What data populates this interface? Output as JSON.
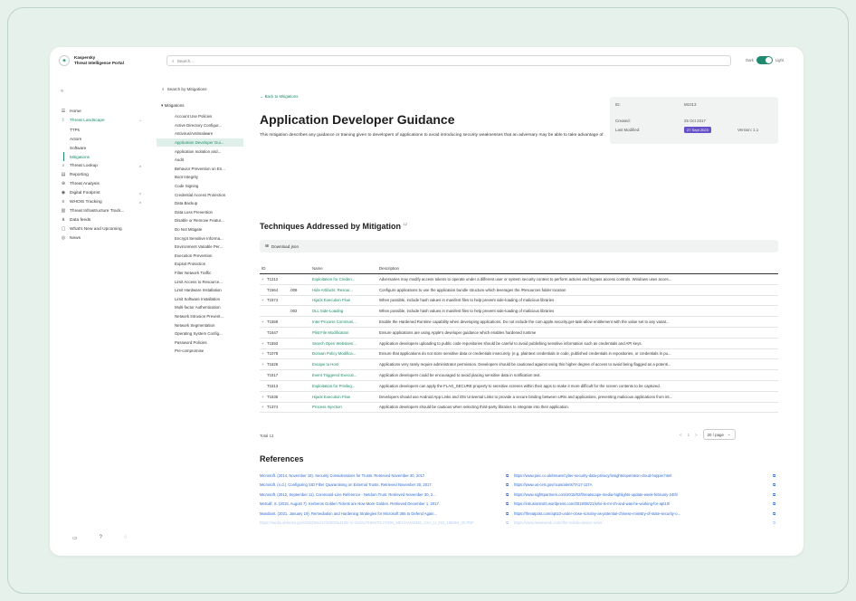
{
  "brand": {
    "line1": "Kaspersky",
    "line2": "Threat Intelligence Portal"
  },
  "search": {
    "placeholder": "Search..."
  },
  "theme": {
    "left": "Dark",
    "right": "Light"
  },
  "sidebar": {
    "collapse": "«",
    "items": [
      {
        "icon": "☰",
        "label": "Home"
      },
      {
        "icon": "⌇",
        "label": "Threat Landscape",
        "chev": "^"
      },
      {
        "label": "TTPs"
      },
      {
        "label": "Actors"
      },
      {
        "label": "Software"
      },
      {
        "label": "Mitigations"
      },
      {
        "icon": "⌕",
        "label": "Threat Lookup",
        "chev": "v"
      },
      {
        "icon": "▤",
        "label": "Reporting"
      },
      {
        "icon": "⊕",
        "label": "Threat Analysis"
      },
      {
        "icon": "◉",
        "label": "Digital Footprint",
        "chev": "v"
      },
      {
        "icon": "≡",
        "label": "WHOIS Tracking",
        "chev": "v"
      },
      {
        "icon": "▥",
        "label": "Threat Infrastructure Track..."
      },
      {
        "icon": "⋔",
        "label": "Data feeds"
      },
      {
        "icon": "▢",
        "label": "What's New and Upcoming"
      },
      {
        "icon": "◎",
        "label": "News"
      }
    ],
    "bottom": [
      "▭",
      "?",
      "◌"
    ]
  },
  "mitigations_list": {
    "search_label": "Search by Mitigations",
    "header": "Mitigations",
    "items": [
      "Account Use Policies",
      "Active Directory Configur...",
      "Antivirus/Antimalware",
      "Application Developer Gui...",
      "Application Isolation and...",
      "Audit",
      "Behavior Prevention on En...",
      "Boot Integrity",
      "Code Signing",
      "Credential Access Protection",
      "Data Backup",
      "Data Loss Prevention",
      "Disable or Remove Featur...",
      "Do Not Mitigate",
      "Encrypt Sensitive Informa...",
      "Environment Variable Per...",
      "Execution Prevention",
      "Exploit Protection",
      "Filter Network Traffic",
      "Limit Access to Resource...",
      "Limit Hardware Installation",
      "Limit Software Installation",
      "Multi-factor Authentication",
      "Network Intrusion Prevent...",
      "Network Segmentation",
      "Operating System Config...",
      "Password Policies",
      "Pre-compromise"
    ]
  },
  "detail": {
    "back": "← Back to Mitigations",
    "title": "Application Developer Guidance",
    "description": "This mitigation describes any guidance or training given to developers of applications to avoid introducing security weaknesses that an adversary may be able to take advantage of.",
    "meta": {
      "id_label": "ID:",
      "id_value": "M1013",
      "created_label": "Created:",
      "created_value": "25 Oct 2017",
      "modified_label": "Last Modified:",
      "modified_value": "27 Sept 2023",
      "version_label": "Version:",
      "version_value": "1.1"
    }
  },
  "techniques": {
    "title": "Techniques Addressed by Mitigation",
    "count": "12",
    "download": "Download json",
    "headers": {
      "id": "ID",
      "name": "Name",
      "desc": "Description"
    },
    "rows": [
      {
        "exp": "+",
        "id": "T1212",
        "sub": "",
        "name": "Exploitation for Creden...",
        "desc": "Adversaries may modify access tokens to operate under a different user or system security context to perform actions and bypass access controls. Windows uses acces..."
      },
      {
        "exp": "",
        "id": "T1564",
        "sub": ".009",
        "name": "Hide Artifacts: Resour...",
        "desc": "Configure applications to use the application bundle structure which leverages the /Resources folder location"
      },
      {
        "exp": "+",
        "id": "T1574",
        "sub": "",
        "name": "Hijack Execution Flow",
        "desc": "When possible, include hash values in manifest files to help prevent side-loading of malicious libraries"
      },
      {
        "exp": "",
        "id": "",
        "sub": ".002",
        "name": "DLL Side-Loading",
        "desc": "When possible, include hash values in manifest files to help prevent side-loading of malicious libraries"
      },
      {
        "exp": "+",
        "id": "T1559",
        "sub": "",
        "name": "Inter-Process Communi...",
        "desc": "Enable the Hardened Runtime capability when developing applications. Do not include the com.apple.security.get-task-allow entitlement with the value set to any variat..."
      },
      {
        "exp": "",
        "id": "T1647",
        "sub": "",
        "name": "Plist File Modification",
        "desc": "Ensure applications are using Apple's developer guidance which enables hardened runtime"
      },
      {
        "exp": "+",
        "id": "T1593",
        "sub": "",
        "name": "Search Open Websites/...",
        "desc": "Application developers uploading to public code repositories should be careful to avoid publishing sensitive information such as credentials and API keys."
      },
      {
        "exp": "+",
        "id": "T1078",
        "sub": "",
        "name": "Domain Policy Modifica...",
        "desc": "Ensure that applications do not store sensitive data or credentials insecurely. (e.g. plaintext credentials in code, published credentials in repositories, or credentials in pu..."
      },
      {
        "exp": "+",
        "id": "T1626",
        "sub": "",
        "name": "Escape to Host",
        "desc": "Applications very rarely require administrator permission. Developers should be cautioned against using this higher degree of access to avoid being flagged as a potenti..."
      },
      {
        "exp": "",
        "id": "T1517",
        "sub": "",
        "name": "Event Triggered Executi...",
        "desc": "Application developers could be encouraged to avoid placing sensitive data in notification text."
      },
      {
        "exp": "",
        "id": "T1513",
        "sub": "",
        "name": "Exploitation for Privileg...",
        "desc": "Application developers can apply the FLAG_SECURE property to sensitive screens within their apps to make it more difficult for the screen contents to be captured."
      },
      {
        "exp": "+",
        "id": "T1635",
        "sub": "",
        "name": "Hijack Execution Flow",
        "desc": "Developers should use Android App Links and iOS Universal Links to provide a secure binding between URIs and applications, preventing malicious applications from int..."
      },
      {
        "exp": "+",
        "id": "T1374",
        "sub": "",
        "name": "Process Injection",
        "desc": "Application developers should be cautious when selecting third-party libraries to integrate into their application."
      }
    ],
    "total": "Total 12",
    "pager_prev": "<",
    "pager_page": "1",
    "pager_next": ">",
    "page_size": "20 / page"
  },
  "references": {
    "title": "References",
    "items": [
      {
        "cite": "Microsoft. (2014, November 19). Security Considerations for Trusts. Retrieved November 30, 2017.",
        "url": "https://www.pwc.co.uk/issues/cyber-security-data-privacy/insights/operation-cloud-hopper.html"
      },
      {
        "cite": "Microsoft. (n.d.). Configuring SID Filter Quarantining on External Trusts. Retrieved November 30, 2017.",
        "url": "https://www.us-cert.gov/ncas/alerts/TA17-117A"
      },
      {
        "cite": "Microsoft. (2012, September 11). Command-Line Reference - Netdom Trust. Retrieved November 30, 2...",
        "url": "https://www.sighttpartners.com/2015/02/threatscape-media-highlights-update-week-february-24th/"
      },
      {
        "cite": "Metcalf, S. (2015, August 7). Kerberos Golden Tickets are Now More Golden. Retrieved December 1, 2017.",
        "url": "https://intrusiontruth.wordpress.com/2018/08/21/who-is-mr-zh-and-was-he-working-for-apt10/"
      },
      {
        "cite": "Mandiant. (2021, January 19). Remediation and Hardening Strategies for Microsoft 365 to Defend Again...",
        "url": "https://threatpost.com/apt10-under-close-scrutiny-as-potential-chinese-ministry-of-state-security-o..."
      },
      {
        "cite": "https://media.defense.gov/2020/Dec/17/2002554125/-1/-1/0/AUTHENTICATION_MECHANISMS_CSA_U_OO_198854_20.PDF",
        "url": "https://www.newsweek.com/dhs-mobile-device-news"
      }
    ]
  }
}
